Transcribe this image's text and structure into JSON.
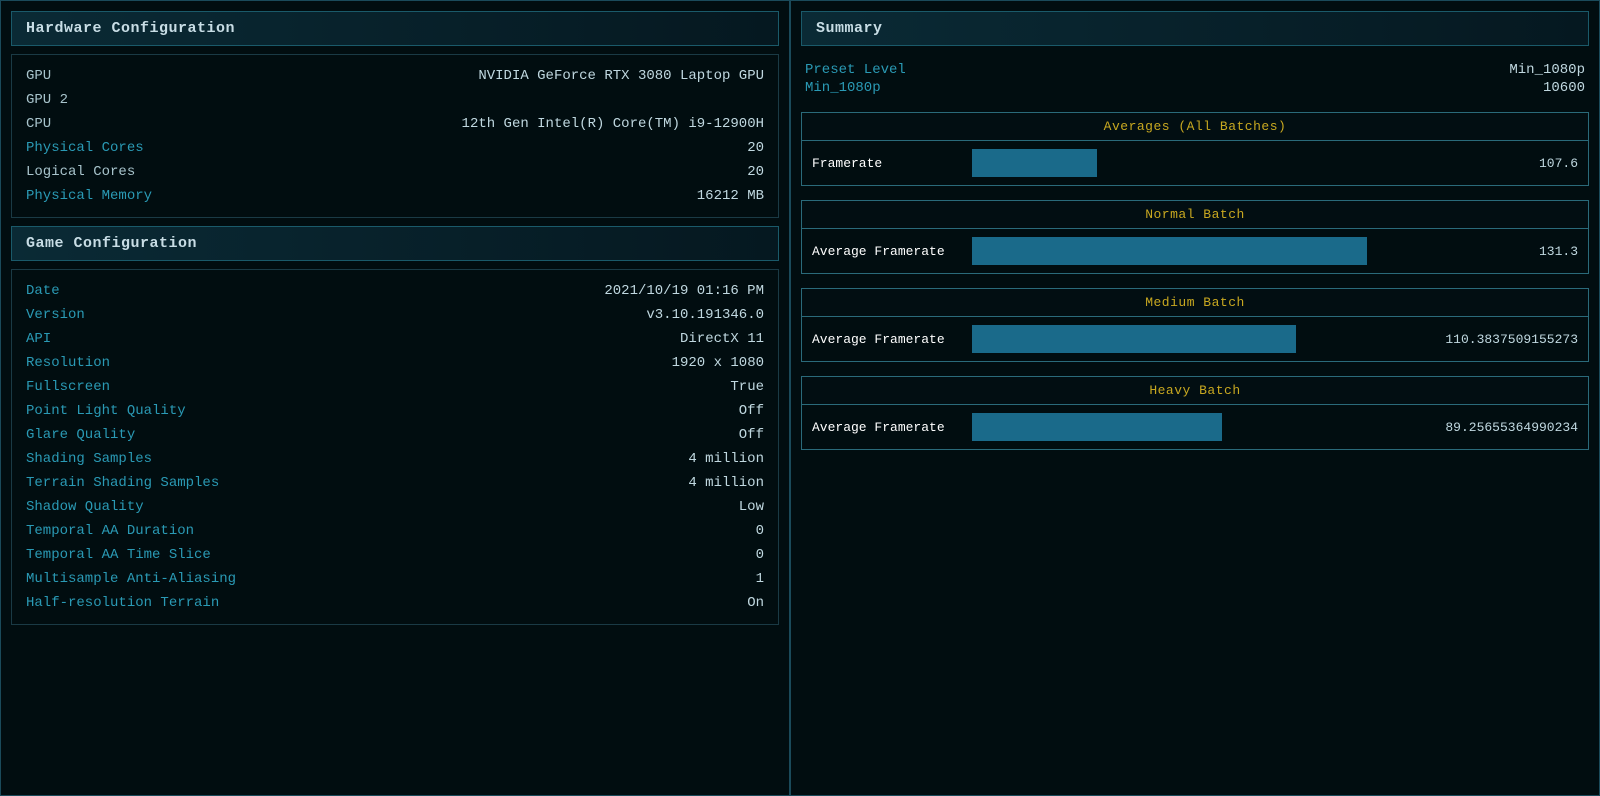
{
  "left": {
    "hardware_header": "Hardware Configuration",
    "hardware_rows": [
      {
        "label": "GPU",
        "label_style": "white",
        "value": "NVIDIA GeForce RTX 3080 Laptop GPU"
      },
      {
        "label": "GPU 2",
        "label_style": "white",
        "value": ""
      },
      {
        "label": "CPU",
        "label_style": "white",
        "value": "12th Gen Intel(R) Core(TM) i9-12900H"
      },
      {
        "label": "Physical Cores",
        "label_style": "blue",
        "value": "20"
      },
      {
        "label": "Logical Cores",
        "label_style": "white",
        "value": "20"
      },
      {
        "label": "Physical Memory",
        "label_style": "blue",
        "value": "16212 MB"
      }
    ],
    "game_header": "Game Configuration",
    "game_rows": [
      {
        "label": "Date",
        "label_style": "blue",
        "value": "2021/10/19 01:16 PM"
      },
      {
        "label": "Version",
        "label_style": "blue",
        "value": "v3.10.191346.0"
      },
      {
        "label": "API",
        "label_style": "blue",
        "value": "DirectX 11"
      },
      {
        "label": "Resolution",
        "label_style": "blue",
        "value": "1920 x 1080"
      },
      {
        "label": "Fullscreen",
        "label_style": "blue",
        "value": "True"
      },
      {
        "label": "Point Light Quality",
        "label_style": "blue",
        "value": "Off"
      },
      {
        "label": "Glare Quality",
        "label_style": "blue",
        "value": "Off"
      },
      {
        "label": "Shading Samples",
        "label_style": "blue",
        "value": "4 million"
      },
      {
        "label": "Terrain Shading Samples",
        "label_style": "blue",
        "value": "4 million"
      },
      {
        "label": "Shadow Quality",
        "label_style": "blue",
        "value": "Low"
      },
      {
        "label": "Temporal AA Duration",
        "label_style": "blue",
        "value": "0"
      },
      {
        "label": "Temporal AA Time Slice",
        "label_style": "blue",
        "value": "0"
      },
      {
        "label": "Multisample Anti-Aliasing",
        "label_style": "blue",
        "value": "1"
      },
      {
        "label": "Half-resolution Terrain",
        "label_style": "blue",
        "value": "On"
      }
    ]
  },
  "right": {
    "summary_header": "Summary",
    "preset_label": "Preset Level",
    "preset_value": "Min_1080p",
    "min_label": "Min_1080p",
    "min_value": "10600",
    "averages_header": "Averages (All Batches)",
    "framerate_label": "Framerate",
    "framerate_value": "107.6",
    "framerate_bar_pct": 30,
    "normal_header": "Normal Batch",
    "normal_label": "Average Framerate",
    "normal_value": "131.3",
    "normal_bar_pct": 95,
    "medium_header": "Medium Batch",
    "medium_label": "Average Framerate",
    "medium_value": "110.3837509155273",
    "medium_bar_pct": 78,
    "heavy_header": "Heavy Batch",
    "heavy_label": "Average Framerate",
    "heavy_value": "89.25655364990234",
    "heavy_bar_pct": 60
  }
}
